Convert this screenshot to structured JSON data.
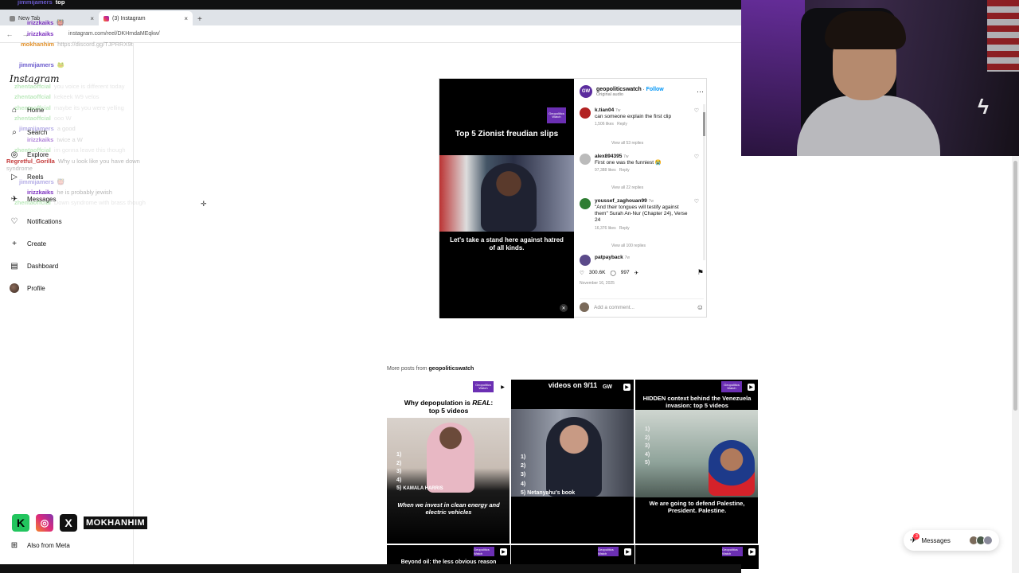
{
  "browser": {
    "tabs": [
      {
        "label": "New Tab",
        "active": false
      },
      {
        "label": "(3) Instagram",
        "active": true
      }
    ],
    "new_tab_symbol": "+",
    "url": "instagram.com/reel/DKHmdaMEqkw/"
  },
  "sidebar": {
    "logo": "Instagram",
    "items": [
      {
        "label": "Home",
        "icon": "home-icon",
        "glyph": "⌂"
      },
      {
        "label": "Search",
        "icon": "search-icon",
        "glyph": "⌕"
      },
      {
        "label": "Explore",
        "icon": "explore-icon",
        "glyph": "◎"
      },
      {
        "label": "Reels",
        "icon": "reels-icon",
        "glyph": "▷"
      },
      {
        "label": "Messages",
        "icon": "messages-icon",
        "glyph": "✈"
      },
      {
        "label": "Notifications",
        "icon": "heart-icon",
        "glyph": "♡"
      },
      {
        "label": "Create",
        "icon": "plus-icon",
        "glyph": "+"
      },
      {
        "label": "Dashboard",
        "icon": "dashboard-icon",
        "glyph": "▤"
      },
      {
        "label": "Profile",
        "icon": "avatar",
        "glyph": ""
      }
    ],
    "also_from_meta": "Also from Meta"
  },
  "chat": [
    {
      "user": "jimmijamers",
      "msg": "top",
      "cls": "u-jimmi"
    },
    {
      "user": "irizzkaiks",
      "msg": "",
      "cls": "u-irizz"
    },
    {
      "user": "irizzkaiks",
      "msg": "",
      "cls": "u-irizz"
    },
    {
      "user": "mokhanhim",
      "msg": "https://discord.gg/TJPRRX9t",
      "cls": "u-mok"
    },
    {
      "user": "jimmijamers",
      "msg": "",
      "cls": "u-jimmi"
    },
    {
      "user": "zhentaoffcial",
      "msg": "you voice is different today",
      "cls": "u-zhz"
    },
    {
      "user": "zhentaoffcial",
      "msg": "kekeek W9 velos",
      "cls": "u-zhz"
    },
    {
      "user": "zhentaoffcial",
      "msg": "maybe its you were yelling",
      "cls": "u-zhz"
    },
    {
      "user": "zhentaoffcial",
      "msg": "ooo W",
      "cls": "u-zhz"
    },
    {
      "user": "jimmijamers",
      "msg": "a good",
      "cls": "u-jimmi"
    },
    {
      "user": "irizzkaiks",
      "msg": "twice a W",
      "cls": "u-irizz"
    },
    {
      "user": "zhentaoffcial",
      "msg": "im gonna leave this though",
      "cls": "u-zhz"
    },
    {
      "user": "Regretful_Gorilla",
      "msg": "Why u look like you have down syndrome",
      "cls": "u-reg"
    },
    {
      "user": "jimmijamers",
      "msg": "",
      "cls": "u-jimmi"
    },
    {
      "user": "irizzkaiks",
      "msg": "he is probably jewish",
      "cls": "u-irizz"
    },
    {
      "user": "zhentaoffcial",
      "msg": "Down syndrome with brass though",
      "cls": "u-zhz"
    }
  ],
  "social": {
    "kick": "K",
    "instagram": "◎",
    "x": "X",
    "name": "MOKHANHIM"
  },
  "post": {
    "media": {
      "title": "Top 5 Zionist freudian slips",
      "badge": "Geopolitics Watch",
      "caption": "Let's take a stand here against hatred of all kinds."
    },
    "header": {
      "avatar": "GW",
      "handle": "geopoliticswatch",
      "follow": "Follow",
      "audio": "Original audio"
    },
    "comments": [
      {
        "user": "k.tian04",
        "time": "7w",
        "text": "can someone explain the first clip",
        "likes": "1,506 likes",
        "reply": "Reply",
        "view": "View all 53 replies"
      },
      {
        "user": "alex894395",
        "time": "7w",
        "text": "First one was the funniest 😭",
        "likes": "97,388 likes",
        "reply": "Reply",
        "view": "View all 22 replies"
      },
      {
        "user": "youssef_zaghouan99",
        "time": "7w",
        "text": "\"And their tongues will testify against them\" Surah An-Nur (Chapter 24), Verse 24",
        "likes": "16,376 likes",
        "reply": "Reply",
        "view": "View all 100 replies"
      },
      {
        "user": "patpayback",
        "time": "7w",
        "text": "",
        "likes": "",
        "reply": "",
        "view": ""
      }
    ],
    "likes": "300.6K",
    "comments_count": "997",
    "date": "November 16, 2025",
    "add_comment": "Add a comment..."
  },
  "more_posts": {
    "prefix": "More posts from",
    "account": "geopoliticswatch",
    "tiles": [
      {
        "title_a": "Why depopulation is ",
        "title_em": "REAL",
        "title_b": ":",
        "title_c": "top 5 videos",
        "list": [
          "1)",
          "2)",
          "3)",
          "4)",
          "5)"
        ],
        "name_tag": "KAMALA HARRIS",
        "caption": "When we invest in clean energy and electric vehicles",
        "badge": "Geopolitics Watch"
      },
      {
        "title": "videos on 9/11",
        "list": [
          "1)",
          "2)",
          "3)",
          "4)",
          "5) Netanyahu's book"
        ],
        "badge": "GW"
      },
      {
        "title": "HIDDEN context behind the Venezuela invasion: top 5 videos",
        "list": [
          "1)",
          "2)",
          "3)",
          "4)",
          "5)"
        ],
        "caption": "We are going to defend Palestine, President. Palestine.",
        "badge": "Geopolitics Watch"
      }
    ],
    "row2": [
      {
        "title": "Beyond oil: the less obvious reason",
        "badge": "Geopolitics Watch"
      },
      {
        "title": "",
        "badge": "Geopolitics Watch"
      },
      {
        "title": "",
        "badge": "Geopolitics Watch"
      }
    ]
  },
  "messages_pill": {
    "label": "Messages",
    "badge": "3"
  },
  "colors": {
    "accent_purple": "#6b2fb3",
    "follow_blue": "#0095f6",
    "notification_red": "#ff3040"
  }
}
